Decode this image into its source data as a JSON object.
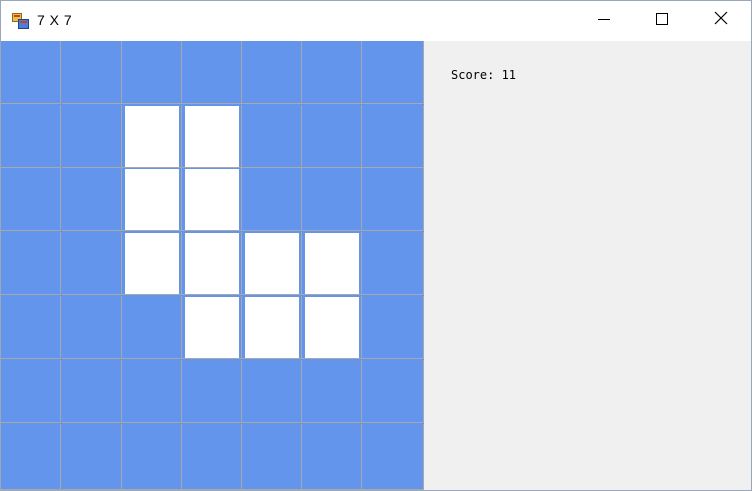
{
  "window": {
    "title": "7 X 7"
  },
  "board": {
    "rows": 7,
    "cols": 7,
    "cells": [
      [
        0,
        0,
        0,
        0,
        0,
        0,
        0
      ],
      [
        0,
        0,
        1,
        1,
        0,
        0,
        0
      ],
      [
        0,
        0,
        1,
        1,
        0,
        0,
        0
      ],
      [
        0,
        0,
        1,
        1,
        1,
        1,
        0
      ],
      [
        0,
        0,
        0,
        1,
        1,
        1,
        0
      ],
      [
        0,
        0,
        0,
        0,
        0,
        0,
        0
      ],
      [
        0,
        0,
        0,
        0,
        0,
        0,
        0
      ]
    ],
    "empty_color": "#6495ed",
    "filled_color": "#ffffff"
  },
  "score": {
    "text": "Score: 11"
  },
  "icons": {
    "app": "app-window-icon",
    "minimize": "minimize-icon",
    "maximize": "maximize-icon",
    "close": "close-icon"
  }
}
